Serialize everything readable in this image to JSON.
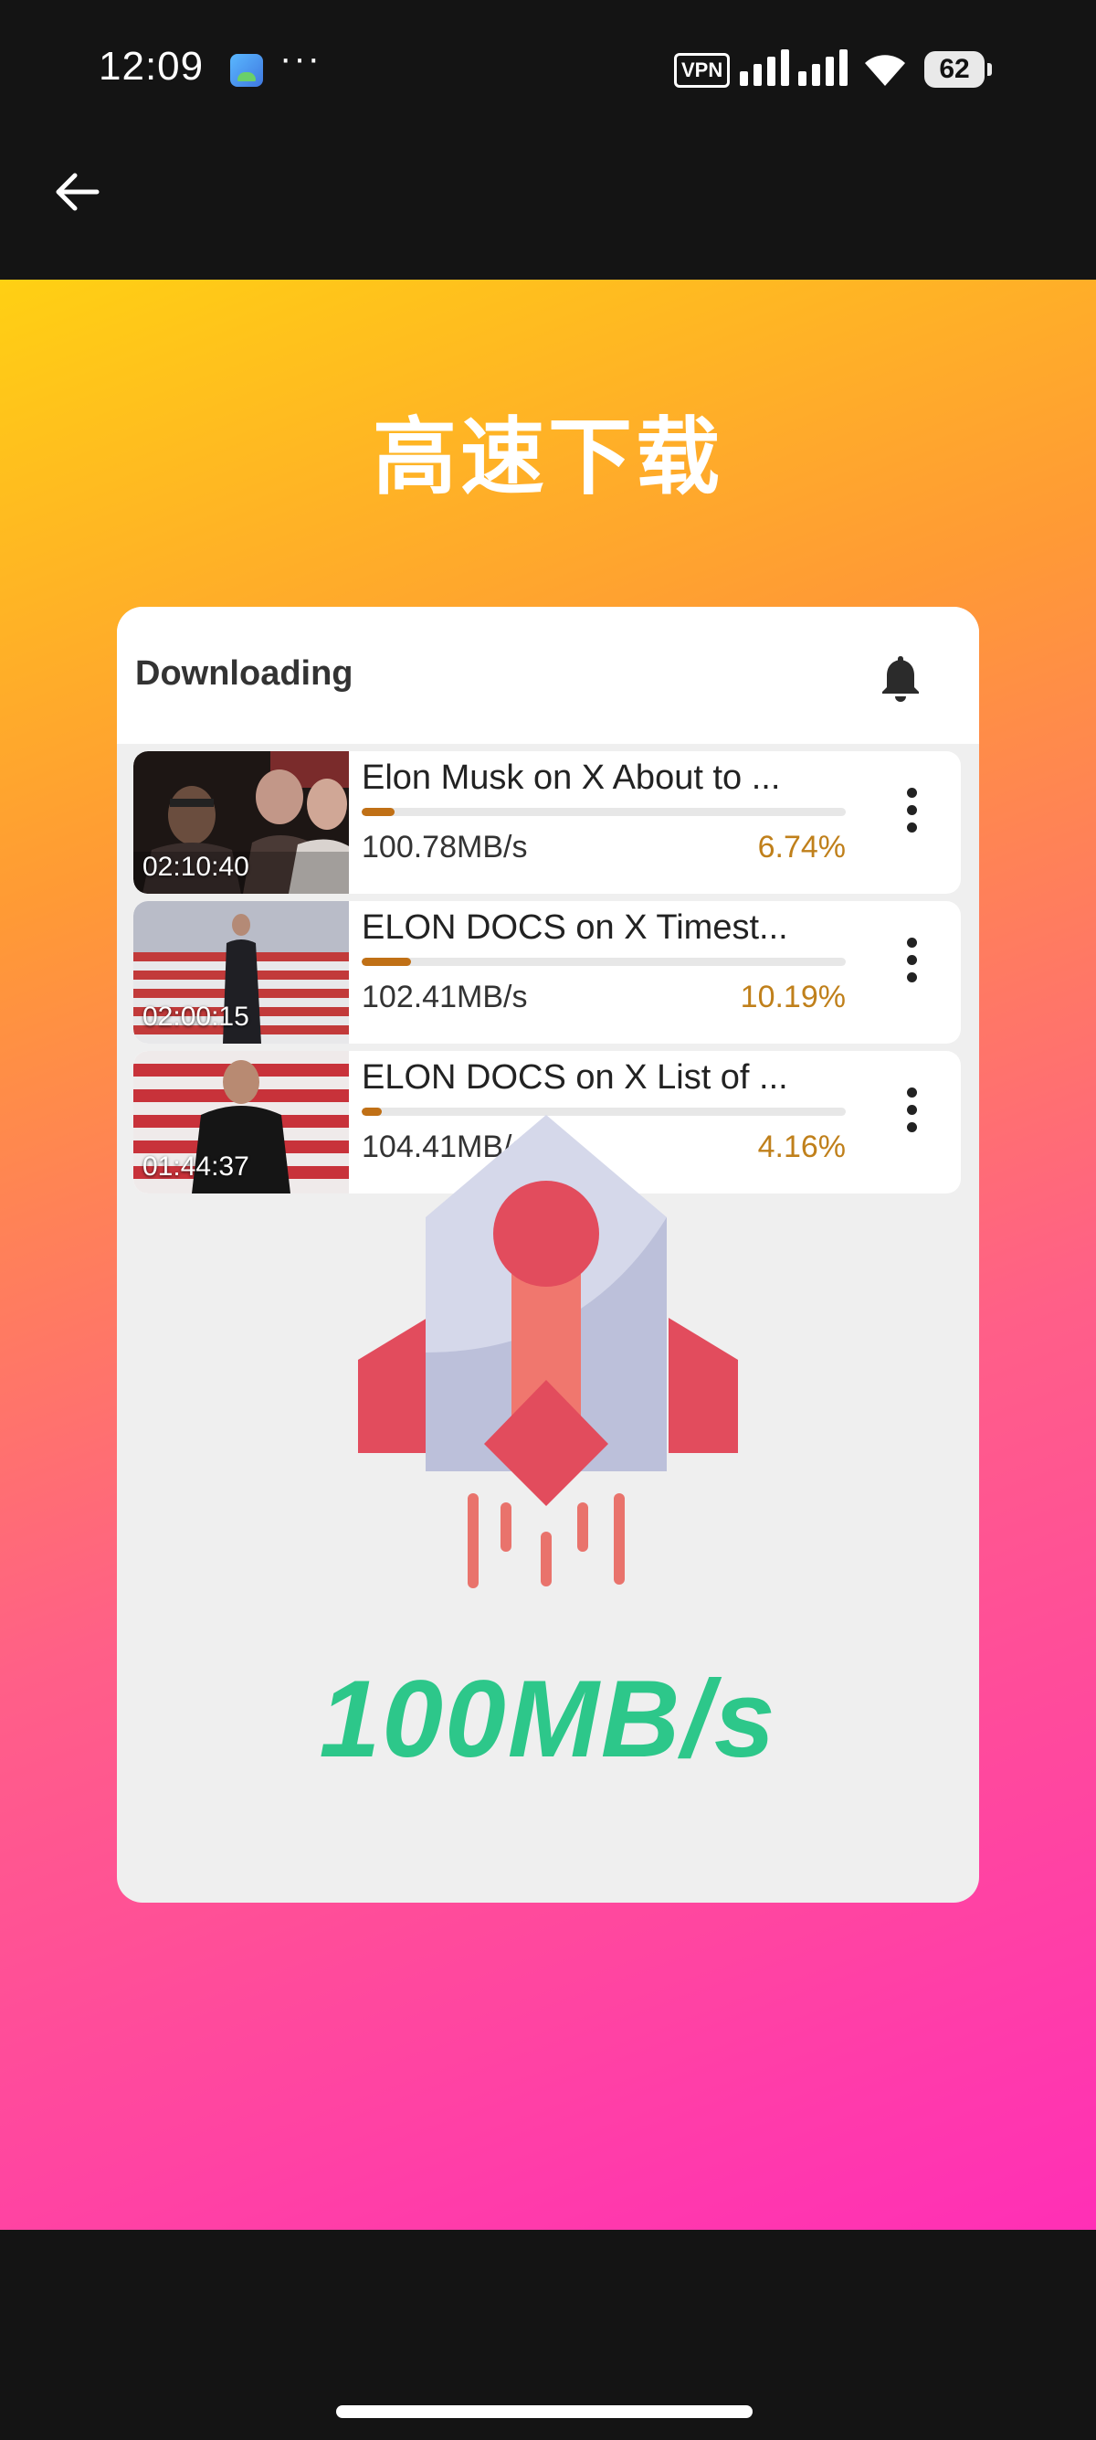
{
  "status_bar": {
    "time": "12:09",
    "more": "···",
    "vpn": "VPN",
    "battery": "62"
  },
  "promo": {
    "title": "高速下载",
    "card": {
      "header_title": "Downloading",
      "items": [
        {
          "title": "Elon Musk on X About to ...",
          "duration": "02:10:40",
          "speed": "100.78MB/s",
          "percent": "6.74%",
          "progress": 0.0674
        },
        {
          "title": "ELON DOCS on X Timest...",
          "duration": "02:00:15",
          "speed": "102.41MB/s",
          "percent": "10.19%",
          "progress": 0.1019
        },
        {
          "title": "ELON DOCS on X List of ...",
          "duration": "01:44:37",
          "speed": "104.41MB/s",
          "percent": "4.16%",
          "progress": 0.0416
        }
      ],
      "speed_label": "100MB/s"
    }
  },
  "icons": {
    "back": "arrow-left-icon",
    "bell": "bell-icon",
    "more": "more-vertical-icon",
    "rocket": "rocket-illustration"
  },
  "colors": {
    "progress": "#c07016",
    "percent": "#c0801b",
    "speed_label": "#2dc78a",
    "rocket_red": "#e24c5d"
  }
}
